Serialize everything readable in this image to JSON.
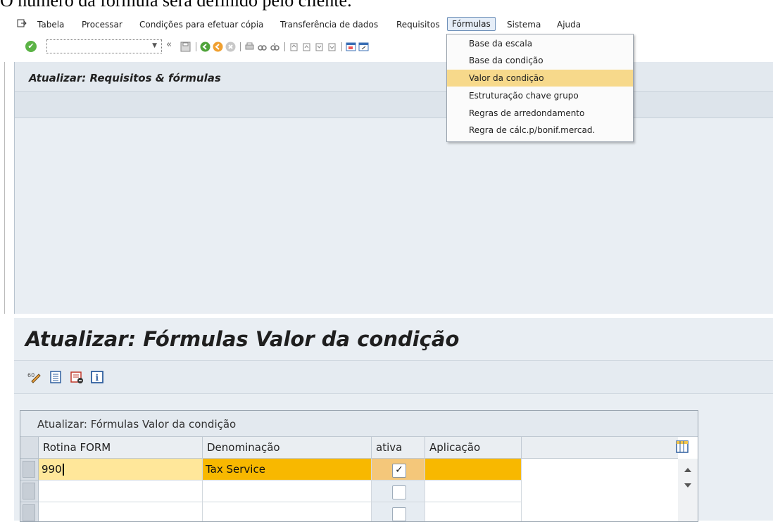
{
  "document": {
    "top_text": "O número da fórmula será definido pelo cliente."
  },
  "menubar": {
    "items": [
      "Tabela",
      "Processar",
      "Condições para efetuar cópia",
      "Transferência de dados",
      "Requisitos",
      "Fórmulas",
      "Sistema",
      "Ajuda"
    ],
    "active_item": "Fórmulas"
  },
  "formulas_menu": {
    "items": [
      "Base da escala",
      "Base da condição",
      "Valor da condição",
      "Estruturação chave grupo",
      "Regras de arredondamento",
      "Regra de cálc.p/bonif.mercad."
    ],
    "highlighted": "Valor da condição"
  },
  "toolbar": {
    "chevron": "«",
    "ok_glyph": "✔"
  },
  "upper_panel": {
    "title": "Atualizar: Requisitos & fórmulas"
  },
  "lower": {
    "title": "Atualizar: Fórmulas Valor da condição",
    "table_title": "Atualizar: Fórmulas Valor da condição",
    "columns": [
      "Rotina FORM",
      "Denominação",
      "ativa",
      "Aplicação"
    ],
    "rows": [
      {
        "rotina": "990",
        "denominacao": "Tax Service",
        "ativa": true,
        "aplicacao": ""
      },
      {
        "rotina": "",
        "denominacao": "",
        "ativa": false,
        "aplicacao": ""
      },
      {
        "rotina": "",
        "denominacao": "",
        "ativa": false,
        "aplicacao": ""
      }
    ]
  },
  "colors": {
    "highlight": "#f7d98b",
    "selected_row": "#f8b800",
    "panel": "#e9eef3"
  }
}
